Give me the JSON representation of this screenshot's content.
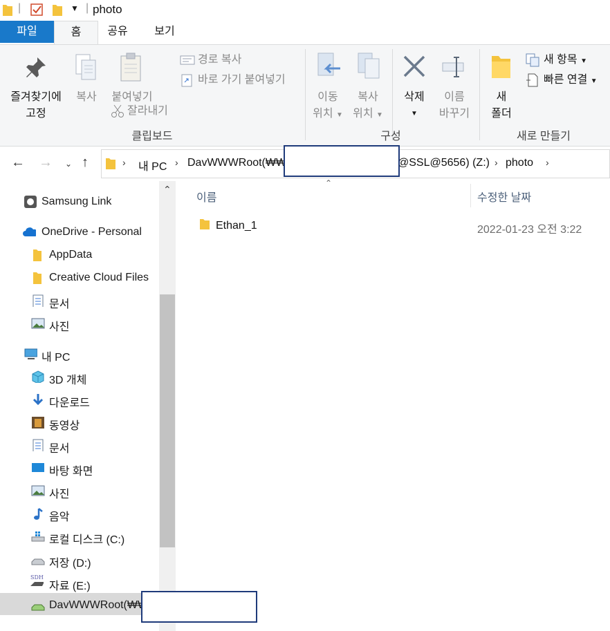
{
  "window": {
    "title": "photo"
  },
  "ribbon_tabs": {
    "file": "파일",
    "home": "홈",
    "share": "공유",
    "view": "보기"
  },
  "ribbon": {
    "pin_line1": "즐겨찾기에",
    "pin_line2": "고정",
    "copy": "복사",
    "paste": "붙여넣기",
    "copy_path": "경로 복사",
    "paste_shortcut": "바로 가기 붙여넣기",
    "cut": "잘라내기",
    "clipboard_group": "클립보드",
    "move_line1": "이동",
    "move_line2": "위치",
    "copyto_line1": "복사",
    "copyto_line2": "위치",
    "delete": "삭제",
    "rename_line1": "이름",
    "rename_line2": "바꾸기",
    "organize_group": "구성",
    "new_folder_line1": "새",
    "new_folder_line2": "폴더",
    "new_item": "새 항목",
    "easy_access": "빠른 연결",
    "new_group": "새로 만들기"
  },
  "address": {
    "crumbs": [
      "내 PC",
      "DavWWWRoot(₩₩",
      "@SSL@5656) (Z:)",
      "photo"
    ]
  },
  "navpane": {
    "items": [
      {
        "label": "Samsung Link",
        "icon": "samsung-link-icon"
      },
      {
        "label": "OneDrive - Personal",
        "icon": "onedrive-cloud-icon"
      },
      {
        "label": "AppData",
        "icon": "folder-icon"
      },
      {
        "label": "Creative Cloud Files",
        "icon": "folder-icon"
      },
      {
        "label": "문서",
        "icon": "document-icon"
      },
      {
        "label": "사진",
        "icon": "pictures-icon"
      },
      {
        "label": "내 PC",
        "icon": "this-pc-icon"
      },
      {
        "label": "3D 개체",
        "icon": "3d-objects-icon"
      },
      {
        "label": "다운로드",
        "icon": "download-arrow-icon"
      },
      {
        "label": "동영상",
        "icon": "video-icon"
      },
      {
        "label": "문서",
        "icon": "document-icon"
      },
      {
        "label": "바탕 화면",
        "icon": "desktop-icon"
      },
      {
        "label": "사진",
        "icon": "pictures-icon"
      },
      {
        "label": "음악",
        "icon": "music-note-icon"
      },
      {
        "label": "로컬 디스크 (C:)",
        "icon": "windows-drive-icon"
      },
      {
        "label": "저장 (D:)",
        "icon": "drive-icon"
      },
      {
        "label": "자료 (E:)",
        "icon": "sdhc-card-icon"
      },
      {
        "label": "DavWWWRoot(₩₩",
        "icon": "network-drive-icon"
      }
    ]
  },
  "columns": {
    "name": "이름",
    "date": "수정한 날짜"
  },
  "files": [
    {
      "name": "Ethan_1",
      "date": "2022-01-23 오전 3:22"
    }
  ],
  "colors": {
    "accent": "#1979ca",
    "folder": "#f4c33d",
    "redaction_border": "#1e3a7a"
  }
}
